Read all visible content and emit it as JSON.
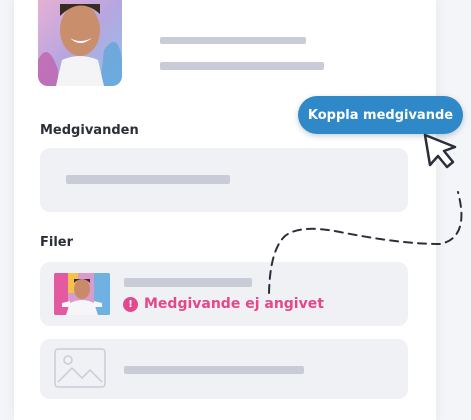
{
  "sections": {
    "consents_heading": "Medgivanden",
    "files_heading": "Filer"
  },
  "file_list": {
    "warning_text": "Medgivande ej angivet",
    "warning_icon": "exclamation-icon"
  },
  "callout": {
    "button_label": "Koppla medgivande"
  },
  "colors": {
    "accent_blue": "#2f88c8",
    "warning_pink": "#e5478b",
    "placeholder_gray": "#c9ccd6"
  }
}
